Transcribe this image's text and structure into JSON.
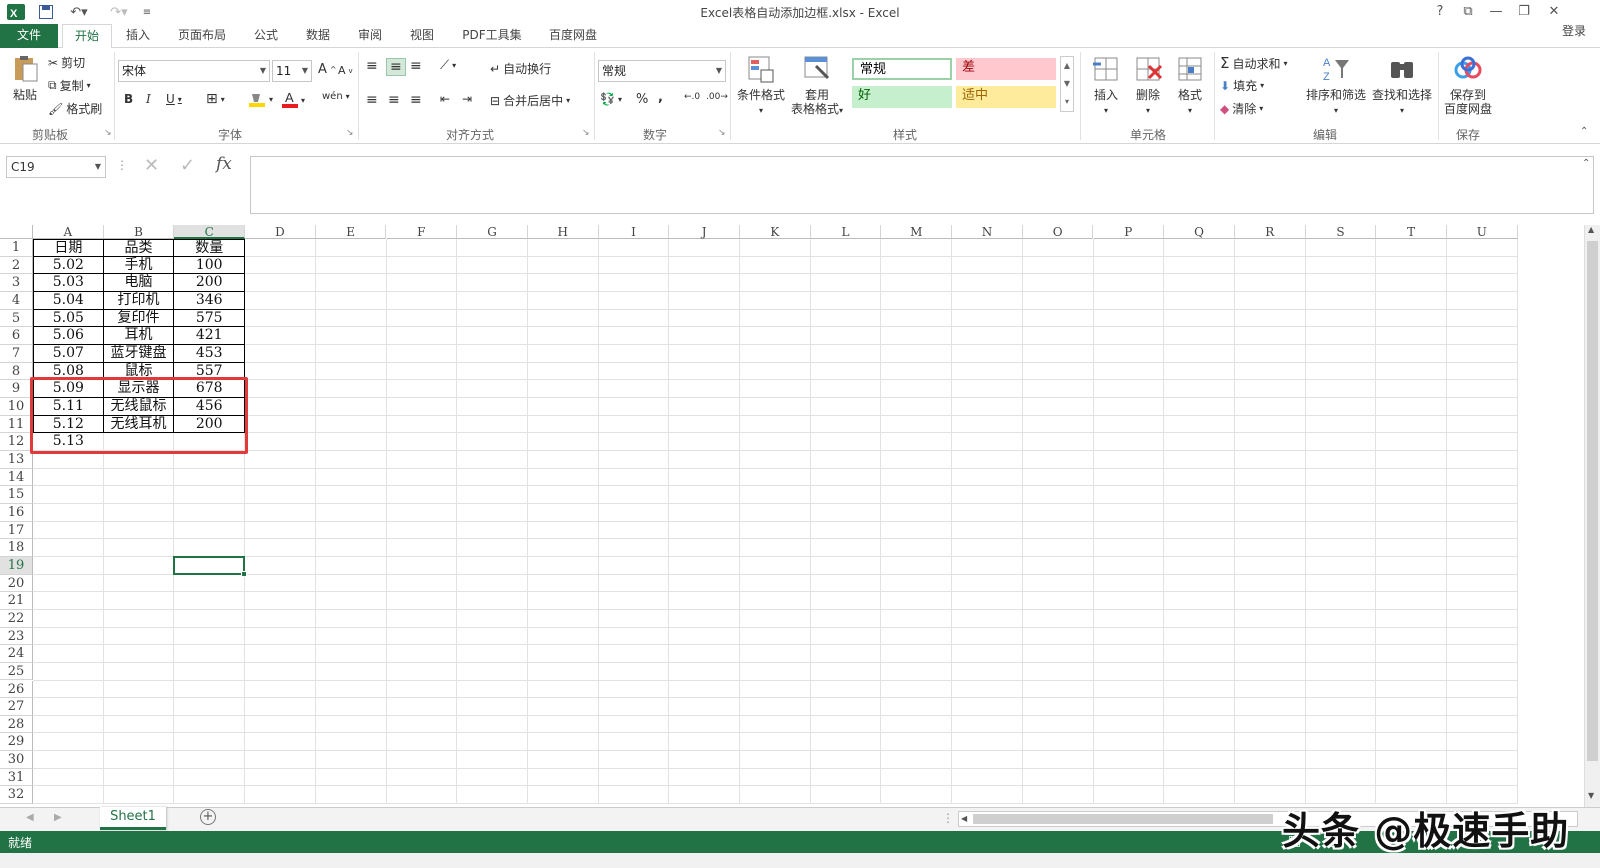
{
  "window": {
    "title": "Excel表格自动添加边框.xlsx - Excel",
    "help": "?",
    "login": "登录"
  },
  "tabs": [
    "文件",
    "开始",
    "插入",
    "页面布局",
    "公式",
    "数据",
    "审阅",
    "视图",
    "PDF工具集",
    "百度网盘"
  ],
  "ribbon": {
    "clipboard": {
      "paste": "粘贴",
      "cut": "剪切",
      "copy": "复制",
      "format_painter": "格式刷",
      "label": "剪贴板"
    },
    "font": {
      "name": "宋体",
      "size": "11",
      "label": "字体"
    },
    "alignment": {
      "wrap": "自动换行",
      "merge": "合并后居中",
      "label": "对齐方式"
    },
    "number": {
      "format": "常规",
      "label": "数字"
    },
    "styles": {
      "cond_format": "条件格式",
      "table_format_1": "套用",
      "table_format_2": "表格格式",
      "normal": "常规",
      "bad": "差",
      "good": "好",
      "neutral": "适中",
      "label": "样式"
    },
    "cells": {
      "insert": "插入",
      "delete": "删除",
      "format": "格式",
      "label": "单元格"
    },
    "editing": {
      "autosum": "自动求和",
      "fill": "填充",
      "clear": "清除",
      "sort": "排序和筛选",
      "find": "查找和选择",
      "label": "编辑"
    },
    "save": {
      "btn_1": "保存到",
      "btn_2": "百度网盘",
      "label": "保存"
    }
  },
  "formula_bar": {
    "name_box": "C19",
    "fx": "fx"
  },
  "columns": [
    "A",
    "B",
    "C",
    "D",
    "E",
    "F",
    "G",
    "H",
    "I",
    "J",
    "K",
    "L",
    "M",
    "N",
    "O",
    "P",
    "Q",
    "R",
    "S",
    "T",
    "U"
  ],
  "rows": [
    "1",
    "2",
    "3",
    "4",
    "5",
    "6",
    "7",
    "8",
    "9",
    "10",
    "11",
    "12",
    "13",
    "14",
    "15",
    "16",
    "17",
    "18",
    "19",
    "20",
    "21",
    "22",
    "23",
    "24",
    "25",
    "26",
    "27",
    "28",
    "29",
    "30",
    "31",
    "32"
  ],
  "table": [
    [
      "日期",
      "品类",
      "数量"
    ],
    [
      "5.02",
      "手机",
      "100"
    ],
    [
      "5.03",
      "电脑",
      "200"
    ],
    [
      "5.04",
      "打印机",
      "346"
    ],
    [
      "5.05",
      "复印件",
      "575"
    ],
    [
      "5.06",
      "耳机",
      "421"
    ],
    [
      "5.07",
      "蓝牙键盘",
      "453"
    ],
    [
      "5.08",
      "鼠标",
      "557"
    ],
    [
      "5.09",
      "显示器",
      "678"
    ],
    [
      "5.11",
      "无线鼠标",
      "456"
    ],
    [
      "5.12",
      "无线耳机",
      "200"
    ],
    [
      "5.13",
      "",
      ""
    ]
  ],
  "sheets": [
    "Sheet1"
  ],
  "status": {
    "ready": "就绪"
  },
  "watermark": "头条 @极速手助",
  "colors": {
    "accent": "#217346",
    "highlight": "#e03a3a"
  }
}
